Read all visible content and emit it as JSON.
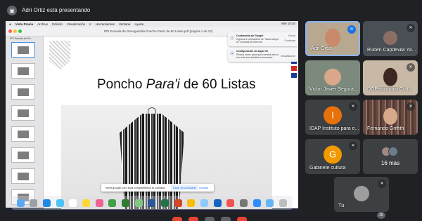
{
  "presenter": {
    "text": "Adri Ortiz está presentando",
    "icon": "presentation-icon"
  },
  "mac_menu": {
    "apple": "",
    "items": [
      "Vista Previa",
      "Archivo",
      "Edición",
      "Visualización",
      "Ir",
      "Herramientas",
      "Ventana",
      "Ayuda"
    ],
    "clock": "Mié 10:40"
  },
  "preview": {
    "doc_title": "PPI Escuela de Genoguardia Poncho Para'i de 60 Listas.pdf (página 1 de 10)",
    "thumb_label": "PPI Escuela de Ge..."
  },
  "slide": {
    "title_a": "Poncho ",
    "title_b": "Para'i",
    "title_c": " de 60 Listas"
  },
  "notifications": [
    {
      "title": "Contraseña de Google",
      "body": "Ingresa a contraseña de \"llaverodego\" en Cuentas de Internet.",
      "action1": "Cerrar",
      "action2": "Continuar"
    },
    {
      "title": "Configuración de Apple ID",
      "body": "Revisa cómo para que cuentes ahora tus más sus detalles encuentres.",
      "action1": "",
      "action2": "Visualización"
    }
  ],
  "share_bar": {
    "text": "meet.google.com está compartiendo tu pantalla.",
    "stop": "Dejar de compartir",
    "hide": "Ocultar"
  },
  "participants": [
    {
      "name": "Adri Ortiz",
      "state": "speaking"
    },
    {
      "name": "Ruben Capdevila Ya...",
      "state": "muted"
    },
    {
      "name": "Victor Javier Segura...",
      "state": "none"
    },
    {
      "name": "DGPatrimonio Cult...",
      "state": "muted"
    },
    {
      "name": "IDAP Instituto para e...",
      "state": "muted",
      "letter": "I",
      "color": "#e8710a"
    },
    {
      "name": "Fernando Griffith",
      "state": "muted"
    },
    {
      "name": "Gabinete cultura",
      "state": "muted",
      "letter": "G",
      "color": "#f29900"
    },
    {
      "name": "16 más",
      "state": "none"
    },
    {
      "name": "Tú",
      "state": "muted"
    }
  ],
  "badge_count": "26",
  "colors": {
    "meet_bg": "#202124",
    "tile_bg": "#3c4043",
    "speaking_blue": "#1a73e8"
  }
}
